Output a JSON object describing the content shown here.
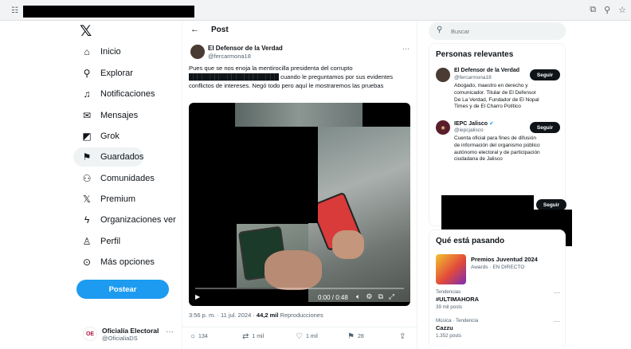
{
  "browser": {
    "tune_icon": "tune-icon",
    "right_icons": [
      "cast-icon",
      "zoom-icon",
      "star-icon"
    ]
  },
  "nav": {
    "logo": "𝕏",
    "items": [
      {
        "label": "Inicio",
        "icon": "home-icon",
        "glyph": "⌂"
      },
      {
        "label": "Explorar",
        "icon": "search-icon",
        "glyph": "⚲"
      },
      {
        "label": "Notificaciones",
        "icon": "bell-icon",
        "glyph": "♫"
      },
      {
        "label": "Mensajes",
        "icon": "mail-icon",
        "glyph": "✉"
      },
      {
        "label": "Grok",
        "icon": "grok-icon",
        "glyph": "◩"
      },
      {
        "label": "Guardados",
        "icon": "bookmark-icon",
        "glyph": "⚑"
      },
      {
        "label": "Comunidades",
        "icon": "communities-icon",
        "glyph": "⚇"
      },
      {
        "label": "Premium",
        "icon": "premium-icon",
        "glyph": "𝕏"
      },
      {
        "label": "Organizaciones ver",
        "icon": "lightning-icon",
        "glyph": "ϟ"
      },
      {
        "label": "Perfil",
        "icon": "profile-icon",
        "glyph": "♙"
      },
      {
        "label": "Más opciones",
        "icon": "more-options-icon",
        "glyph": "⊙"
      }
    ],
    "post_button": "Postear",
    "account": {
      "name": "Oficialía Electoral",
      "handle": "@OficialiaDS",
      "logo_text": "OE",
      "more": "···"
    }
  },
  "center": {
    "back": "←",
    "title": "Post",
    "author": {
      "name": "El Defensor de la Verdad",
      "handle": "@fercarmona18"
    },
    "more": "···",
    "text": "Pues que se nos enoja la mentirocilla presidenta del corrupto █████████████████████ cuando le preguntamos por sus evidentes conflictos de intereses. Negó todo pero aquí le mostraremos las pruebas",
    "video": {
      "time": "0:00 / 0:48",
      "play": "▶"
    },
    "meta": {
      "time": "3:56 p. m. · 11 jul. 2024 · ",
      "views": "44,2 mil",
      "views_label": " Reproducciones"
    },
    "actions": [
      {
        "icon": "reply-icon",
        "glyph": "○",
        "count": "134"
      },
      {
        "icon": "repost-icon",
        "glyph": "⇄",
        "count": "1 mil"
      },
      {
        "icon": "like-icon",
        "glyph": "♡",
        "count": "1 mil"
      },
      {
        "icon": "bookmark-icon",
        "glyph": "⚑",
        "count": "28"
      },
      {
        "icon": "share-icon",
        "glyph": "⇪",
        "count": ""
      }
    ]
  },
  "right": {
    "search_placeholder": "Buscar",
    "relevant_title": "Personas relevantes",
    "people": [
      {
        "name": "El Defensor de la Verdad",
        "handle": "@fercarmona18",
        "bio": "Abogado, maestro en derecho y comunicador. Titular de El Defensor De La Verdad, Fundador de El Nopal Times y de El Charro Político",
        "follow": "Seguir"
      },
      {
        "name": "IEPC Jalisco",
        "handle": "@iepcjalisco",
        "bio": "Cuenta oficial para fines de difusión de información del organismo público autónomo electoral y de participación ciudadana de Jalisco",
        "follow": "Seguir"
      }
    ],
    "third_follow": "Seguir",
    "trends_title": "Qué está pasando",
    "feature": {
      "name": "Premios Juventud 2024",
      "sub": "Awards · EN DIRECTO"
    },
    "trends": [
      {
        "category": "Tendencias",
        "name": "#ULTIMAHORA",
        "count": "39 mil posts"
      },
      {
        "category": "Música · Tendencia",
        "name": "Cazzu",
        "count": "1.352 posts"
      }
    ]
  }
}
